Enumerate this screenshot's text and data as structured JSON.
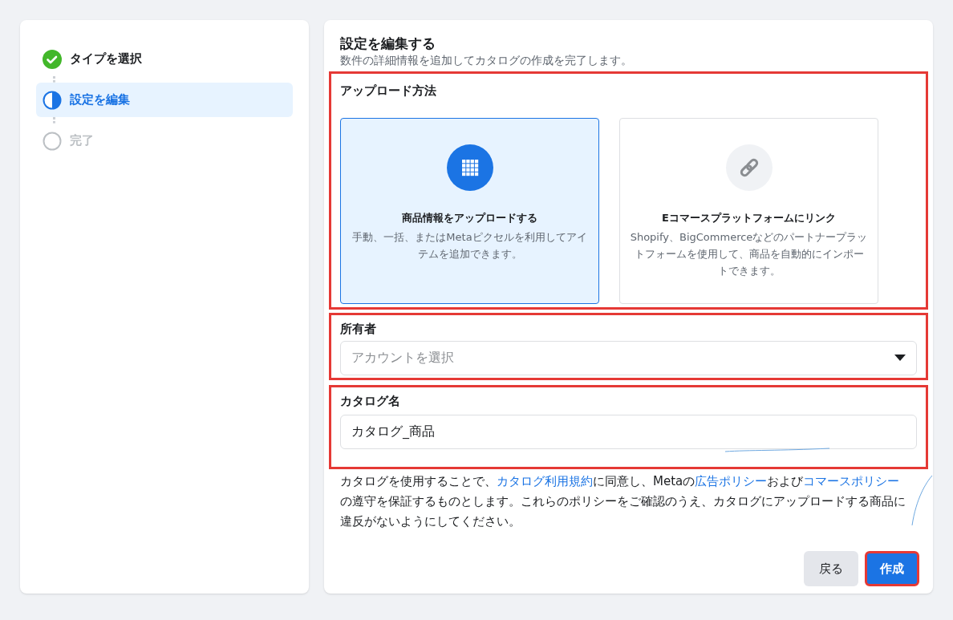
{
  "steps": [
    {
      "label": "タイプを選択",
      "kind": "done",
      "selected": false
    },
    {
      "label": "設定を編集",
      "kind": "current",
      "selected": true
    },
    {
      "label": "完了",
      "kind": "todo",
      "selected": false
    }
  ],
  "header": {
    "title": "設定を編集する",
    "subtitle": "数件の詳細情報を追加してカタログの作成を完了します。"
  },
  "upload_method": {
    "label": "アップロード方法",
    "highlighted": true,
    "options": [
      {
        "kind": "grid",
        "title": "商品情報をアップロードする",
        "description": "手動、一括、またはMetaピクセルを利用してアイテムを追加できます。",
        "selected": true
      },
      {
        "kind": "link",
        "title": "Eコマースプラットフォームにリンク",
        "description": "Shopify、BigCommerceなどのパートナープラットフォームを使用して、商品を自動的にインポートできます。",
        "selected": false
      }
    ]
  },
  "owner": {
    "label": "所有者",
    "highlighted": true,
    "placeholder": "アカウントを選択"
  },
  "catalog_name": {
    "label": "カタログ名",
    "highlighted": true,
    "value": "カタログ_商品"
  },
  "legal": [
    {
      "kind": "text",
      "text": "カタログを使用することで、"
    },
    {
      "kind": "link",
      "text": "カタログ利用規約"
    },
    {
      "kind": "text",
      "text": "に同意し、Metaの"
    },
    {
      "kind": "link",
      "text": "広告ポリシー"
    },
    {
      "kind": "text",
      "text": "および"
    },
    {
      "kind": "link",
      "text": "コマースポリシー"
    },
    {
      "kind": "text",
      "text": "の遵守を保証するものとします。これらのポリシーをご確認のうえ、カタログにアップロードする商品に違反がないようにしてください。"
    }
  ],
  "buttons": [
    {
      "label": "戻る",
      "kind": "secondary",
      "highlighted": false
    },
    {
      "label": "作成",
      "kind": "primary",
      "highlighted": true
    }
  ]
}
